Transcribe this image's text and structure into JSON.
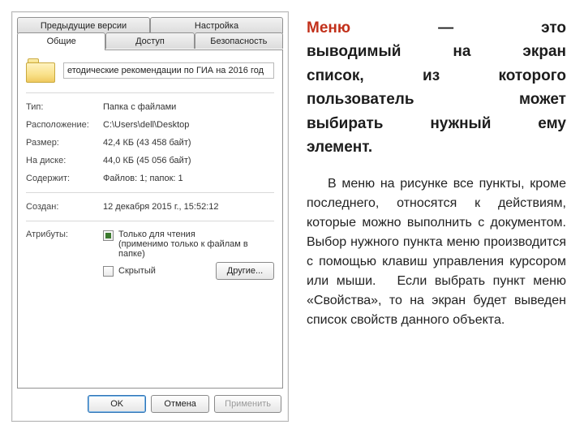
{
  "dialog": {
    "tabs_row1": [
      "Предыдущие версии",
      "Настройка"
    ],
    "tabs_row2": [
      "Общие",
      "Доступ",
      "Безопасность"
    ],
    "active_tab": "Общие",
    "folder_name": "етодические рекомендации по ГИА на 2016 год",
    "props": {
      "type_label": "Тип:",
      "type_value": "Папка с файлами",
      "location_label": "Расположение:",
      "location_value": "C:\\Users\\dell\\Desktop",
      "size_label": "Размер:",
      "size_value": "42,4 КБ (43 458 байт)",
      "ondisk_label": "На диске:",
      "ondisk_value": "44,0 КБ (45 056 байт)",
      "contains_label": "Содержит:",
      "contains_value": "Файлов: 1; папок: 1",
      "created_label": "Создан:",
      "created_value": "12 декабря 2015 г., 15:52:12",
      "attr_label": "Атрибуты:"
    },
    "attributes": {
      "readonly": "Только для чтения",
      "readonly_note": "(применимо только к файлам в папке)",
      "hidden": "Скрытый",
      "other_btn": "Другие..."
    },
    "buttons": {
      "ok": "OK",
      "cancel": "Отмена",
      "apply": "Применить"
    }
  },
  "text": {
    "def_menu": "Меню",
    "def_rest_1": " — это",
    "def_line2": "выводимый на экран",
    "def_line3": "список, из которого",
    "def_line4": "пользователь может",
    "def_line5": "выбирать нужный ему",
    "def_line6": "элемент.",
    "body": "В меню на рисунке все пункты, кроме последнего, относятся к действиям, которые можно выполнить с документом. Выбор нужного пункта меню производится с помощью клавиш управления курсором или мыши.",
    "body_tail": "Если выбрать пункт меню «Свойства», то на экран будет выведен список свойств данного объекта."
  }
}
